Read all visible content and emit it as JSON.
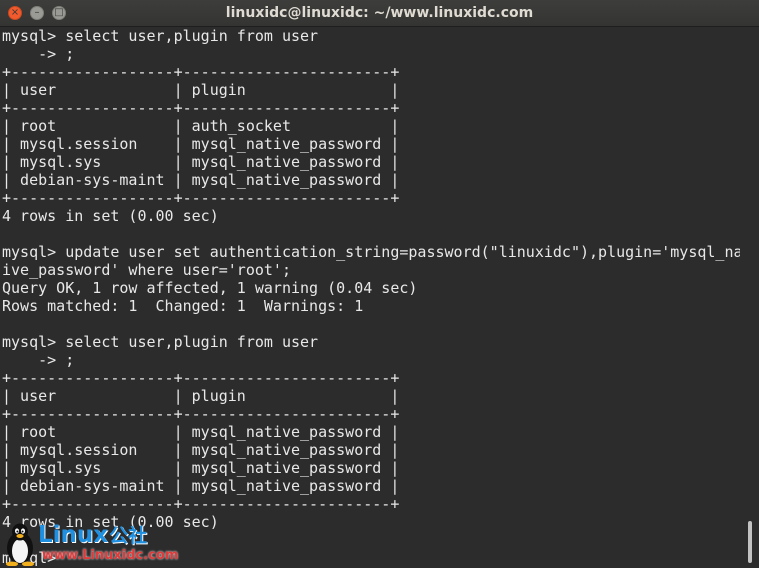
{
  "window": {
    "title": "linuxidc@linuxidc: ~/www.linuxidc.com",
    "close_glyph": "×",
    "minimize_glyph": "–",
    "maximize_glyph": "□"
  },
  "terminal": {
    "lines": [
      "mysql> select user,plugin from user",
      "    -> ;",
      "+------------------+-----------------------+",
      "| user             | plugin                |",
      "+------------------+-----------------------+",
      "| root             | auth_socket           |",
      "| mysql.session    | mysql_native_password |",
      "| mysql.sys        | mysql_native_password |",
      "| debian-sys-maint | mysql_native_password |",
      "+------------------+-----------------------+",
      "4 rows in set (0.00 sec)",
      "",
      "mysql> update user set authentication_string=password(\"linuxidc\"),plugin='mysql_nat",
      "ive_password' where user='root';",
      "Query OK, 1 row affected, 1 warning (0.04 sec)",
      "Rows matched: 1  Changed: 1  Warnings: 1",
      "",
      "mysql> select user,plugin from user",
      "    -> ;",
      "+------------------+-----------------------+",
      "| user             | plugin                |",
      "+------------------+-----------------------+",
      "| root             | mysql_native_password |",
      "| mysql.session    | mysql_native_password |",
      "| mysql.sys        | mysql_native_password |",
      "| debian-sys-maint | mysql_native_password |",
      "+------------------+-----------------------+",
      "4 rows in set (0.00 sec)",
      "",
      "mysql> "
    ]
  },
  "watermark": {
    "brand": "Linux",
    "brand_cn": "公社",
    "url": "www.Linuxidc.com"
  },
  "colors": {
    "terminal_bg": "#2c2c2c",
    "terminal_fg": "#e8e8e8",
    "titlebar_bg": "#3d3d3b",
    "close_button": "#f05a2d",
    "watermark_blue": "#1f8fe0",
    "watermark_red": "#e03a3a"
  },
  "icons": {
    "close": "close-icon",
    "minimize": "minimize-icon",
    "maximize": "maximize-icon",
    "penguin": "tux-penguin-icon"
  }
}
